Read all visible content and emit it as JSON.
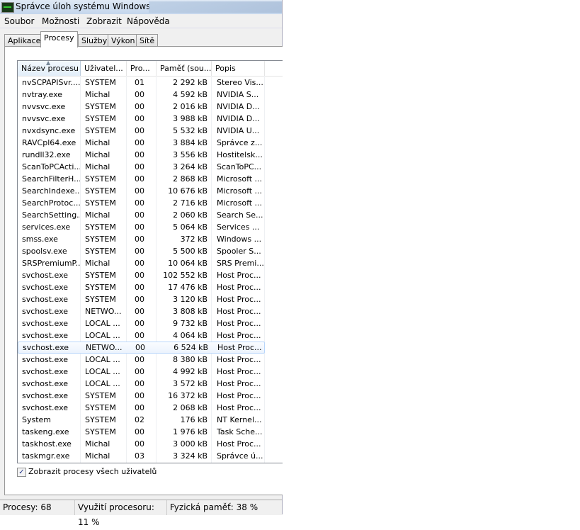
{
  "window": {
    "title": "Správce úloh systému Windows"
  },
  "menu": [
    "Soubor",
    "Možnosti",
    "Zobrazit",
    "Nápověda"
  ],
  "tabs": [
    {
      "label": "Aplikace"
    },
    {
      "label": "Procesy",
      "active": true
    },
    {
      "label": "Služby"
    },
    {
      "label": "Výkon"
    },
    {
      "label": "Sítě"
    }
  ],
  "columns": [
    "Název procesu",
    "Uživatel...",
    "Pro...",
    "Paměť (sou...",
    "Popis"
  ],
  "rows": [
    [
      "nvSCPAPISvr....",
      "SYSTEM",
      "01",
      "2 292 kB",
      "Stereo Vis..."
    ],
    [
      "nvtray.exe",
      "Michal",
      "00",
      "4 592 kB",
      "NVIDIA S..."
    ],
    [
      "nvvsvc.exe",
      "SYSTEM",
      "00",
      "2 016 kB",
      "NVIDIA D..."
    ],
    [
      "nvvsvc.exe",
      "SYSTEM",
      "00",
      "3 988 kB",
      "NVIDIA D..."
    ],
    [
      "nvxdsync.exe",
      "SYSTEM",
      "00",
      "5 532 kB",
      "NVIDIA U..."
    ],
    [
      "RAVCpl64.exe",
      "Michal",
      "00",
      "3 884 kB",
      "Správce z..."
    ],
    [
      "rundll32.exe",
      "Michal",
      "00",
      "3 556 kB",
      "Hostitelsk..."
    ],
    [
      "ScanToPCActi...",
      "Michal",
      "00",
      "3 264 kB",
      "ScanToPC..."
    ],
    [
      "SearchFilterH...",
      "SYSTEM",
      "00",
      "2 868 kB",
      "Microsoft ..."
    ],
    [
      "SearchIndexe...",
      "SYSTEM",
      "00",
      "10 676 kB",
      "Microsoft ..."
    ],
    [
      "SearchProtoc...",
      "SYSTEM",
      "00",
      "2 716 kB",
      "Microsoft ..."
    ],
    [
      "SearchSetting...",
      "Michal",
      "00",
      "2 060 kB",
      "Search Se..."
    ],
    [
      "services.exe",
      "SYSTEM",
      "00",
      "5 064 kB",
      "Services ..."
    ],
    [
      "smss.exe",
      "SYSTEM",
      "00",
      "372 kB",
      "Windows ..."
    ],
    [
      "spoolsv.exe",
      "SYSTEM",
      "00",
      "5 500 kB",
      "Spooler S..."
    ],
    [
      "SRSPremiumP...",
      "Michal",
      "00",
      "10 064 kB",
      "SRS Premi..."
    ],
    [
      "svchost.exe",
      "SYSTEM",
      "00",
      "102 552 kB",
      "Host Proc..."
    ],
    [
      "svchost.exe",
      "SYSTEM",
      "00",
      "17 476 kB",
      "Host Proc..."
    ],
    [
      "svchost.exe",
      "SYSTEM",
      "00",
      "3 120 kB",
      "Host Proc..."
    ],
    [
      "svchost.exe",
      "NETWO...",
      "00",
      "3 808 kB",
      "Host Proc..."
    ],
    [
      "svchost.exe",
      "LOCAL ...",
      "00",
      "9 732 kB",
      "Host Proc..."
    ],
    [
      "svchost.exe",
      "LOCAL ...",
      "00",
      "4 064 kB",
      "Host Proc..."
    ],
    [
      "svchost.exe",
      "NETWO...",
      "00",
      "6 524 kB",
      "Host Proc..."
    ],
    [
      "svchost.exe",
      "LOCAL ...",
      "00",
      "8 380 kB",
      "Host Proc..."
    ],
    [
      "svchost.exe",
      "LOCAL ...",
      "00",
      "4 992 kB",
      "Host Proc..."
    ],
    [
      "svchost.exe",
      "LOCAL ...",
      "00",
      "3 572 kB",
      "Host Proc..."
    ],
    [
      "svchost.exe",
      "SYSTEM",
      "00",
      "16 372 kB",
      "Host Proc..."
    ],
    [
      "svchost.exe",
      "SYSTEM",
      "00",
      "2 068 kB",
      "Host Proc..."
    ],
    [
      "System",
      "SYSTEM",
      "02",
      "176 kB",
      "NT Kernel..."
    ],
    [
      "taskeng.exe",
      "SYSTEM",
      "00",
      "1 976 kB",
      "Task Sche..."
    ],
    [
      "taskhost.exe",
      "Michal",
      "00",
      "3 000 kB",
      "Host Proc..."
    ],
    [
      "taskmgr.exe",
      "Michal",
      "03",
      "3 324 kB",
      "Správce ú..."
    ]
  ],
  "selected_row": 22,
  "show_all_users": {
    "label": "Zobrazit procesy všech uživatelů",
    "checked": true
  },
  "status": {
    "processes": "Procesy: 68",
    "cpu": "Využití procesoru: 11 %",
    "memory": "Fyzická paměť: 38 %"
  }
}
